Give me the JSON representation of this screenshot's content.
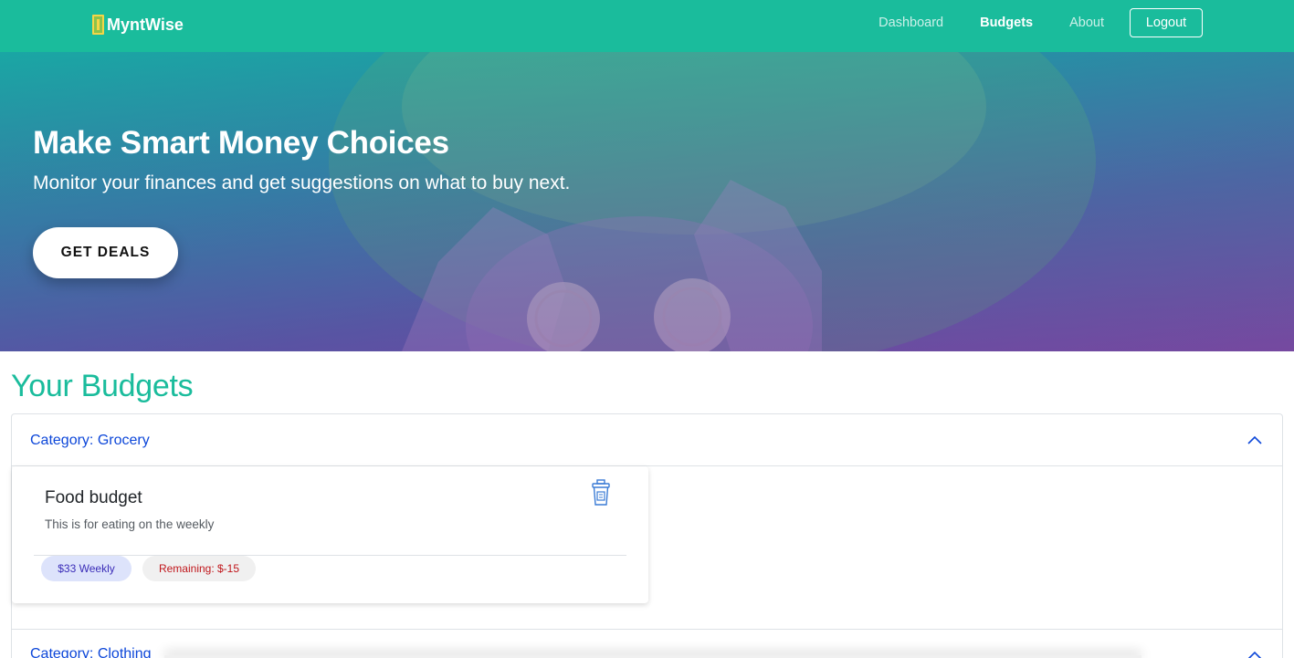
{
  "navbar": {
    "brand": "MyntWise",
    "links": [
      "Dashboard",
      "Budgets",
      "About"
    ],
    "active_link": "Budgets",
    "logout_label": "Logout",
    "color": "#1abc9c"
  },
  "hero": {
    "title": "Make Smart Money Choices",
    "subtitle": "Monitor your finances and get suggestions on what to buy next.",
    "cta_label": "GET DEALS"
  },
  "budgets": {
    "heading": "Your Budgets",
    "categories": [
      {
        "label": "Category: Grocery",
        "expanded": true,
        "items": [
          {
            "title": "Food budget",
            "description": "This is for eating on the weekly",
            "amount_badge": "$33 Weekly",
            "remaining_badge": "Remaining: $-15"
          }
        ]
      },
      {
        "label": "Category: Clothing",
        "expanded": false,
        "items": []
      }
    ]
  },
  "icons": {
    "logo": "money-icon",
    "delete": "trash-icon",
    "expand": "chevron-up-icon"
  },
  "colors": {
    "accent": "#1abc9c",
    "link": "#0d47d9",
    "amount_badge_bg": "#dde3fb",
    "remaining_text": "#c0161b"
  }
}
